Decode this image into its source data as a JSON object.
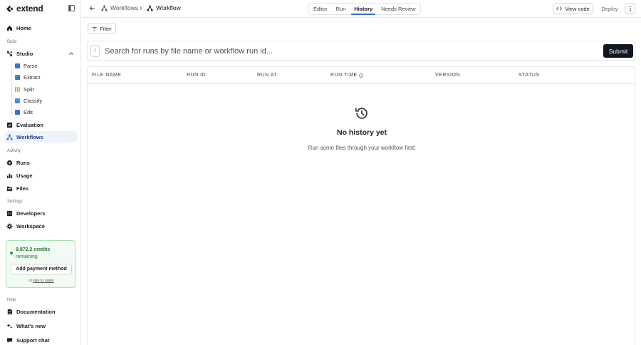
{
  "brand": {
    "name": "extend"
  },
  "sidebar": {
    "home": "Home",
    "section_build": "Build",
    "studio": "Studio",
    "studio_items": [
      "Parse",
      "Extract",
      "Split",
      "Classify",
      "Edit"
    ],
    "evaluation": "Evaluation",
    "workflows": "Workflows",
    "section_activity": "Activity",
    "runs": "Runs",
    "usage": "Usage",
    "files": "Files",
    "section_settings": "Settings",
    "developers": "Developers",
    "workspace": "Workspace",
    "credits": {
      "amount": "9,872.2 credits",
      "remaining": "remaining",
      "add_payment": "Add payment method",
      "or": "or",
      "talk_to_sales": "talk to sales"
    },
    "section_help": "Help",
    "documentation": "Documentation",
    "whats_new": "What's new",
    "support_chat": "Support chat"
  },
  "topbar": {
    "breadcrumb_parent": "Workflows",
    "breadcrumb_current": "Workflow",
    "tabs": [
      {
        "label": "Editor",
        "active": false
      },
      {
        "label": "Run",
        "active": false
      },
      {
        "label": "History",
        "active": true
      },
      {
        "label": "Needs Review",
        "active": false
      }
    ],
    "view_code": "View code",
    "deploy": "Deploy"
  },
  "main": {
    "filter_label": "Filter",
    "search_shortcut": "/",
    "search_placeholder": "Search for runs by file name or workflow run id...",
    "submit_label": "Submit",
    "columns": [
      "FILE NAME",
      "RUN ID",
      "RUN AT",
      "RUN TIME",
      "VERSION",
      "STATUS"
    ],
    "empty_title": "No history yet",
    "empty_subtitle": "Run some files through your workflow first!"
  },
  "colors": {
    "accent": "#2f6fd0",
    "credits_green": "#22a547",
    "submit_bg": "#0f1720"
  }
}
